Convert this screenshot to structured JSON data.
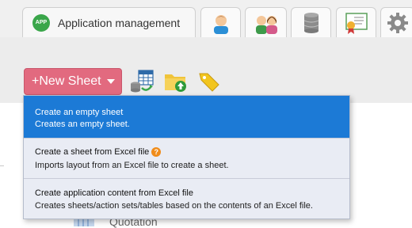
{
  "tabs": {
    "app": {
      "badge": "APP",
      "label": "Application management"
    },
    "icons": [
      "user-icon",
      "group-icon",
      "database-icon",
      "certificate-icon",
      "settings-gear-icon"
    ]
  },
  "toolbar": {
    "new_sheet_label": "+New Sheet",
    "new_sheet_color": "#e26a7f",
    "icons": [
      "excel-database-icon",
      "folder-upload-icon",
      "tag-icon"
    ]
  },
  "menu": {
    "items": [
      {
        "title": "Create an empty sheet",
        "description": "Creates an empty sheet.",
        "selected": true
      },
      {
        "title": "Create a sheet from Excel file",
        "description": "Imports layout from an Excel file to create a sheet.",
        "help": "?"
      },
      {
        "title": "Create application content from Excel file",
        "description": "Creates sheets/action sets/tables based on the contents of an Excel file."
      }
    ],
    "selected_color": "#1c7ad6"
  },
  "background_list": {
    "item_label": "Quotation"
  }
}
